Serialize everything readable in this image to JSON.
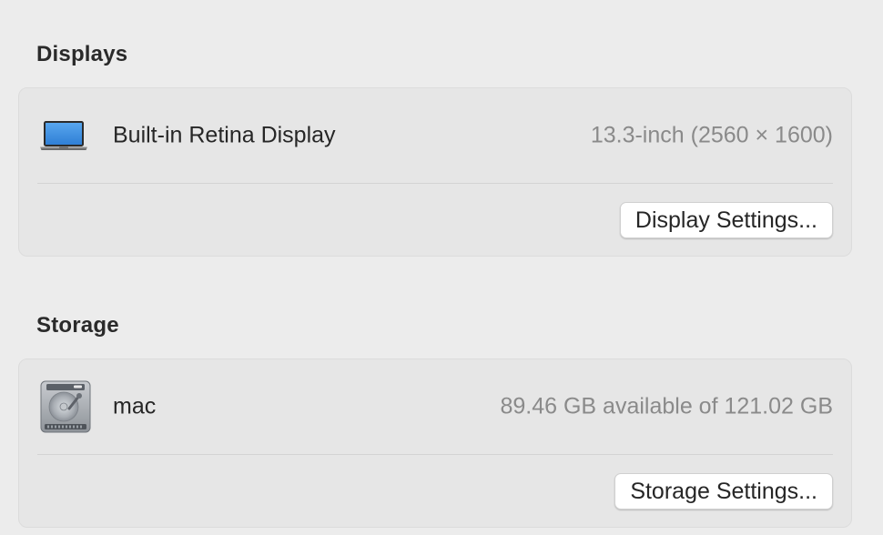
{
  "displays": {
    "title": "Displays",
    "item": {
      "icon": "laptop-icon",
      "name": "Built-in Retina Display",
      "spec": "13.3-inch (2560 × 1600)"
    },
    "settings_button": "Display Settings..."
  },
  "storage": {
    "title": "Storage",
    "item": {
      "icon": "hard-drive-icon",
      "name": "mac",
      "capacity": "89.46 GB available of 121.02 GB"
    },
    "settings_button": "Storage Settings..."
  },
  "colors": {
    "background": "#ececec",
    "group_background": "#e6e6e6",
    "secondary_text": "#8a8a8a",
    "laptop_screen": "#3d8fe0"
  }
}
